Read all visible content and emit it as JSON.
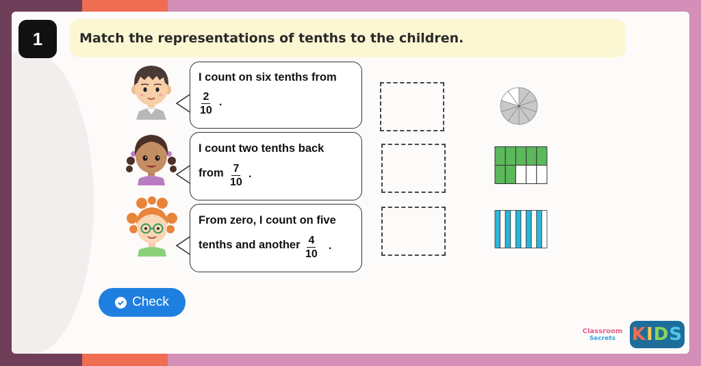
{
  "question": {
    "number": "1",
    "title": "Match the representations of tenths to the children."
  },
  "statements": [
    {
      "child": "boy",
      "line1": "I count on six tenths from",
      "fraction": {
        "numerator": "2",
        "denominator": "10"
      },
      "suffix": "."
    },
    {
      "child": "girl-braids",
      "line1": "I count two tenths back",
      "line2_prefix": "from",
      "fraction": {
        "numerator": "7",
        "denominator": "10"
      },
      "suffix": "."
    },
    {
      "child": "girl-glasses",
      "line1": "From zero, I count on five",
      "line2_prefix": "tenths and another",
      "fraction": {
        "numerator": "4",
        "denominator": "10"
      },
      "suffix": "."
    }
  ],
  "representations": [
    {
      "type": "pie",
      "parts": 10,
      "shaded": 8,
      "color": "#c8c8c8"
    },
    {
      "type": "grid",
      "parts": 10,
      "shaded": 7,
      "color": "#5bb85b"
    },
    {
      "type": "bars",
      "parts": 10,
      "shaded": 5,
      "color": "#29b6d8"
    }
  ],
  "check_button": {
    "label": "Check",
    "color": "#1f7fe0"
  },
  "branding": {
    "classroom": "Classroom",
    "secrets": "Secrets",
    "kids": [
      "K",
      "I",
      "D",
      "S"
    ]
  }
}
